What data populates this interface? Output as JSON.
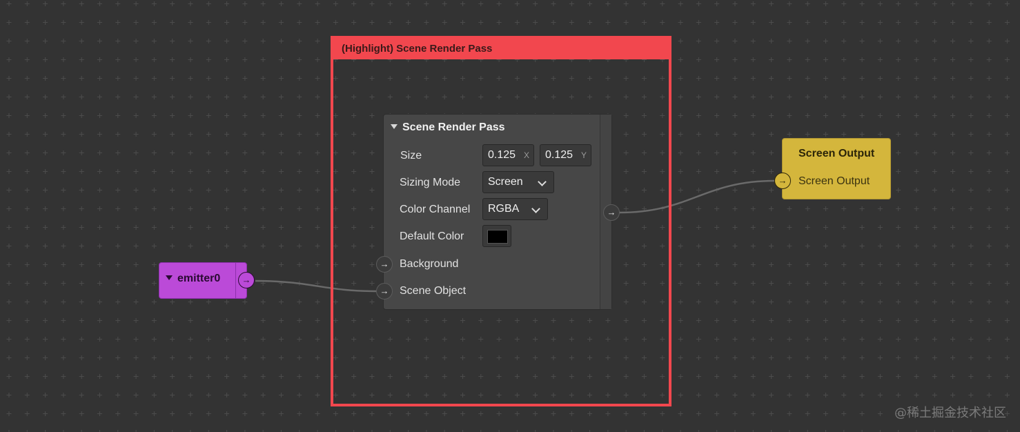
{
  "highlight_group": {
    "title": "(Highlight) Scene Render Pass"
  },
  "render_pass_node": {
    "title": "Scene Render Pass",
    "size_label": "Size",
    "size_x": "0.125",
    "size_x_axis": "X",
    "size_y": "0.125",
    "size_y_axis": "Y",
    "sizing_mode_label": "Sizing Mode",
    "sizing_mode_value": "Screen",
    "color_channel_label": "Color Channel",
    "color_channel_value": "RGBA",
    "default_color_label": "Default Color",
    "default_color_value": "#000000",
    "background_label": "Background",
    "scene_object_label": "Scene Object"
  },
  "emitter_node": {
    "title": "emitter0",
    "color": "#bb4ad8"
  },
  "screen_output_node": {
    "title": "Screen Output",
    "input_label": "Screen Output",
    "color": "#d4b63c"
  },
  "accent_colors": {
    "highlight": "#f2474e",
    "canvas": "#333333"
  },
  "port_arrow": "→",
  "watermark": "@稀土掘金技术社区"
}
